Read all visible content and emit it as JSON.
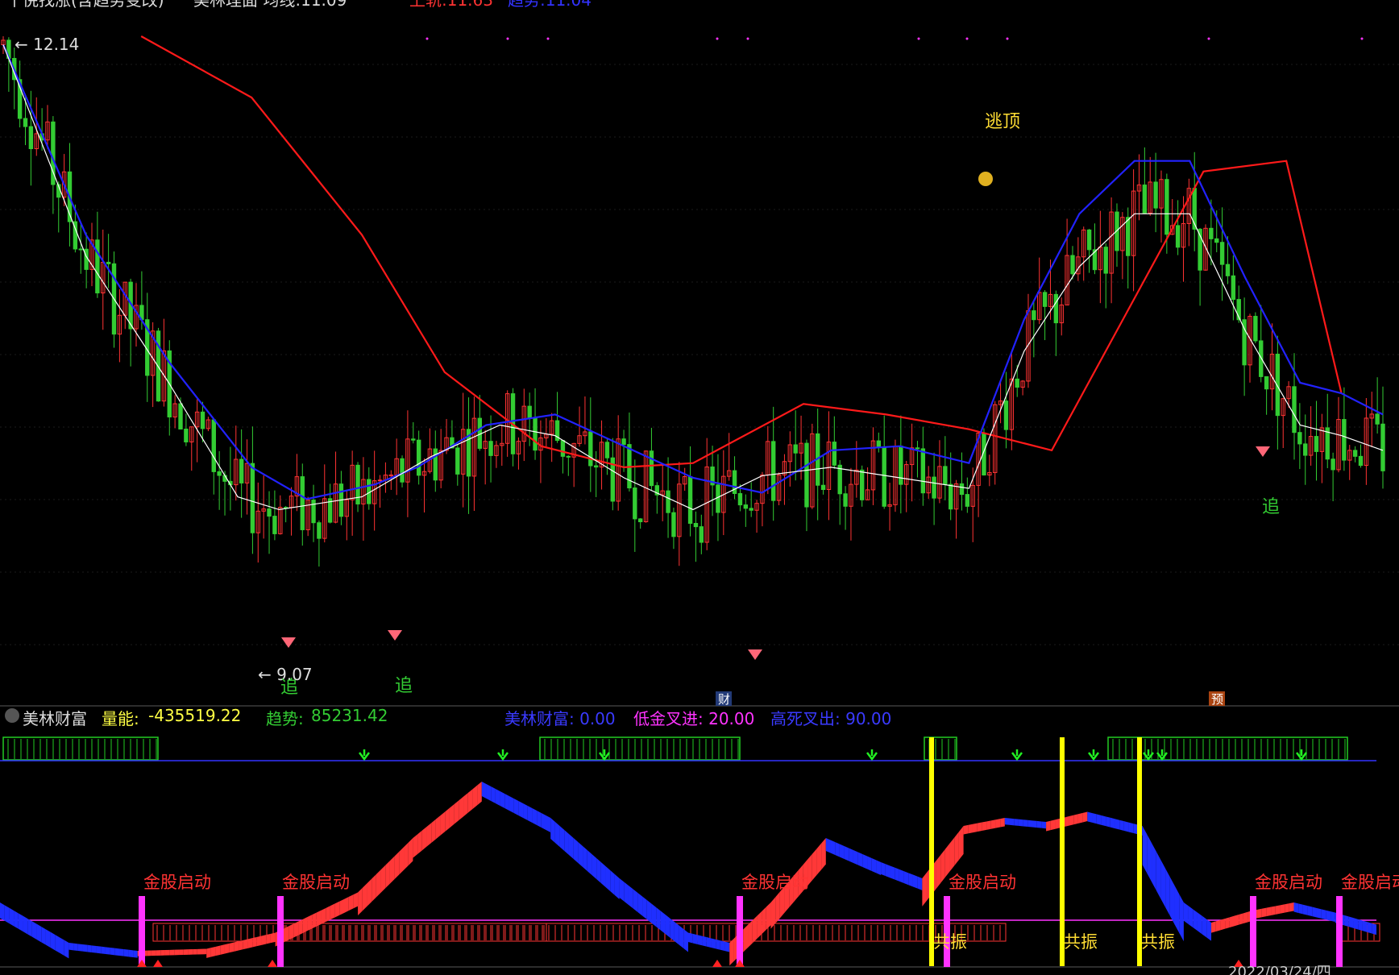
{
  "header": {
    "title_partial": "千倪找涨(含趋势变改)",
    "indicator_partial": "美林理面 均线:11.09",
    "upper_partial": "上轨:11.63",
    "trend_partial": "趋势:11.04"
  },
  "price_panel": {
    "high_label": "12.14",
    "low_label": "9.07",
    "annotations": {
      "escape_top": "逃顶",
      "chase": "追",
      "wealth_badge": "财",
      "forecast_badge": "预"
    }
  },
  "indicator_panel": {
    "name": "美林财富",
    "volume_label": "量能:",
    "volume_value": "-435519.22",
    "trend_label": "趋势:",
    "trend_value": "85231.42",
    "wealth_text": "美林财富: 0.00",
    "low_cross_text": "低金叉进: 20.00",
    "high_cross_text": "高死叉出: 90.00",
    "start_label": "金股启动",
    "resonance_label": "共振"
  },
  "bottom_axis": {
    "date_partial": "2022/03/24/四"
  },
  "colors": {
    "up": "#ff3333",
    "down": "#33cc33",
    "upper_band": "#ff1a1a",
    "trend": "#2222ff",
    "ma": "#ffffff",
    "magenta": "#ff33ff",
    "yellow": "#ffff00",
    "blue_line": "#3333ff",
    "ribbon_up": "#ff3838",
    "ribbon_down": "#1f2fff"
  },
  "chart_data": [
    {
      "type": "line",
      "panel": "price",
      "y_range": [
        9.07,
        12.14
      ],
      "series": [
        {
          "name": "上轨",
          "points": [
            [
              0.1,
              12.14
            ],
            [
              0.18,
              11.85
            ],
            [
              0.26,
              11.2
            ],
            [
              0.32,
              10.55
            ],
            [
              0.39,
              10.2
            ],
            [
              0.45,
              10.1
            ],
            [
              0.5,
              10.12
            ],
            [
              0.58,
              10.4
            ],
            [
              0.64,
              10.35
            ],
            [
              0.7,
              10.28
            ],
            [
              0.76,
              10.18
            ],
            [
              0.82,
              10.9
            ],
            [
              0.87,
              11.5
            ],
            [
              0.93,
              11.55
            ],
            [
              0.97,
              10.45
            ]
          ]
        },
        {
          "name": "趋势",
          "points": [
            [
              0.0,
              12.1
            ],
            [
              0.06,
              11.2
            ],
            [
              0.12,
              10.6
            ],
            [
              0.18,
              10.1
            ],
            [
              0.22,
              9.95
            ],
            [
              0.27,
              10.02
            ],
            [
              0.3,
              10.1
            ],
            [
              0.35,
              10.3
            ],
            [
              0.4,
              10.35
            ],
            [
              0.45,
              10.2
            ],
            [
              0.5,
              10.05
            ],
            [
              0.55,
              9.98
            ],
            [
              0.6,
              10.18
            ],
            [
              0.65,
              10.2
            ],
            [
              0.7,
              10.12
            ],
            [
              0.74,
              10.8
            ],
            [
              0.78,
              11.3
            ],
            [
              0.82,
              11.55
            ],
            [
              0.86,
              11.55
            ],
            [
              0.9,
              11.0
            ],
            [
              0.94,
              10.5
            ],
            [
              0.97,
              10.45
            ],
            [
              1.0,
              10.35
            ]
          ]
        },
        {
          "name": "均线",
          "points": [
            [
              0.0,
              12.1
            ],
            [
              0.06,
              11.1
            ],
            [
              0.12,
              10.5
            ],
            [
              0.17,
              9.96
            ],
            [
              0.2,
              9.9
            ],
            [
              0.26,
              9.96
            ],
            [
              0.31,
              10.15
            ],
            [
              0.36,
              10.3
            ],
            [
              0.4,
              10.25
            ],
            [
              0.45,
              10.05
            ],
            [
              0.5,
              9.9
            ],
            [
              0.55,
              10.06
            ],
            [
              0.6,
              10.1
            ],
            [
              0.65,
              10.05
            ],
            [
              0.7,
              10.0
            ],
            [
              0.74,
              10.65
            ],
            [
              0.78,
              11.05
            ],
            [
              0.82,
              11.3
            ],
            [
              0.86,
              11.3
            ],
            [
              0.9,
              10.75
            ],
            [
              0.94,
              10.3
            ],
            [
              0.97,
              10.25
            ],
            [
              1.0,
              10.18
            ]
          ]
        }
      ]
    },
    {
      "type": "area",
      "panel": "indicator",
      "y_range": [
        0,
        100
      ],
      "thresholds": {
        "low": 20,
        "high": 90
      },
      "series": [
        {
          "name": "美林财富",
          "points": [
            [
              0.0,
              30
            ],
            [
              0.05,
              10
            ],
            [
              0.1,
              6
            ],
            [
              0.15,
              7
            ],
            [
              0.2,
              15
            ],
            [
              0.26,
              35
            ],
            [
              0.3,
              62
            ],
            [
              0.35,
              90
            ],
            [
              0.4,
              72
            ],
            [
              0.45,
              42
            ],
            [
              0.5,
              15
            ],
            [
              0.53,
              10
            ],
            [
              0.56,
              30
            ],
            [
              0.6,
              62
            ],
            [
              0.64,
              50
            ],
            [
              0.67,
              42
            ],
            [
              0.7,
              68
            ],
            [
              0.73,
              72
            ],
            [
              0.76,
              70
            ],
            [
              0.79,
              75
            ],
            [
              0.83,
              68
            ],
            [
              0.86,
              30
            ],
            [
              0.88,
              20
            ],
            [
              0.91,
              26
            ],
            [
              0.94,
              30
            ],
            [
              0.97,
              25
            ],
            [
              1.0,
              19
            ]
          ]
        }
      ]
    }
  ]
}
